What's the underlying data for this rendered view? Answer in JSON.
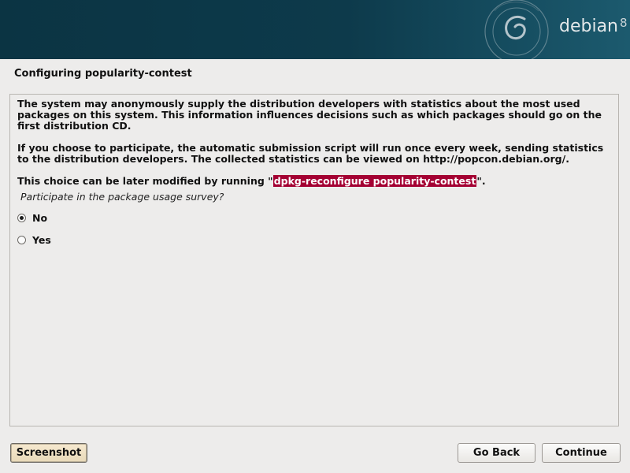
{
  "header": {
    "brand_name": "debian",
    "brand_version": "8"
  },
  "page": {
    "title": "Configuring popularity-contest"
  },
  "content": {
    "paragraph1": "The system may anonymously supply the distribution developers with statistics about the most used packages on this system. This information influences decisions such as which packages should go on the first distribution CD.",
    "paragraph2": "If you choose to participate, the automatic submission script will run once every week, sending statistics to the distribution developers. The collected statistics can be viewed on http://popcon.debian.org/.",
    "paragraph3_prefix": "This choice can be later modified by running \"",
    "paragraph3_command": "dpkg-reconfigure popularity-contest",
    "paragraph3_suffix": "\".",
    "question": "Participate in the package usage survey?",
    "options": [
      {
        "label": "No",
        "selected": true
      },
      {
        "label": "Yes",
        "selected": false
      }
    ]
  },
  "buttons": {
    "screenshot": "Screenshot",
    "go_back": "Go Back",
    "continue": "Continue"
  },
  "colors": {
    "banner": "#0d3a4b",
    "command_highlight": "#a40033",
    "background": "#edeceb"
  },
  "icons": {
    "logo": "debian-swirl-icon",
    "radio_checked": "radio-checked-icon",
    "radio_unchecked": "radio-unchecked-icon"
  }
}
